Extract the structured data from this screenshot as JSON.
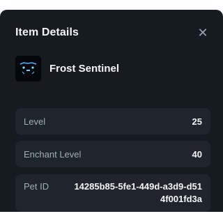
{
  "header": {
    "title": "Item Details",
    "close_icon": "close-icon"
  },
  "item": {
    "name": "Frost Sentinel",
    "icon": "frost-sentinel-icon"
  },
  "stats": {
    "level_label": "Level",
    "level_value": "25",
    "enchant_label": "Enchant Level",
    "enchant_value": "40",
    "pet_label": "Pet ID",
    "pet_value": "14285b85-5fe1-449d-a3d9-d514f001fd3a"
  },
  "colors": {
    "panel_bg": "#161b22",
    "card_bg": "#1f252d",
    "text_primary": "#f3f4f6",
    "text_secondary": "#a4acb6",
    "icon_glow": "#4fb3ff"
  }
}
